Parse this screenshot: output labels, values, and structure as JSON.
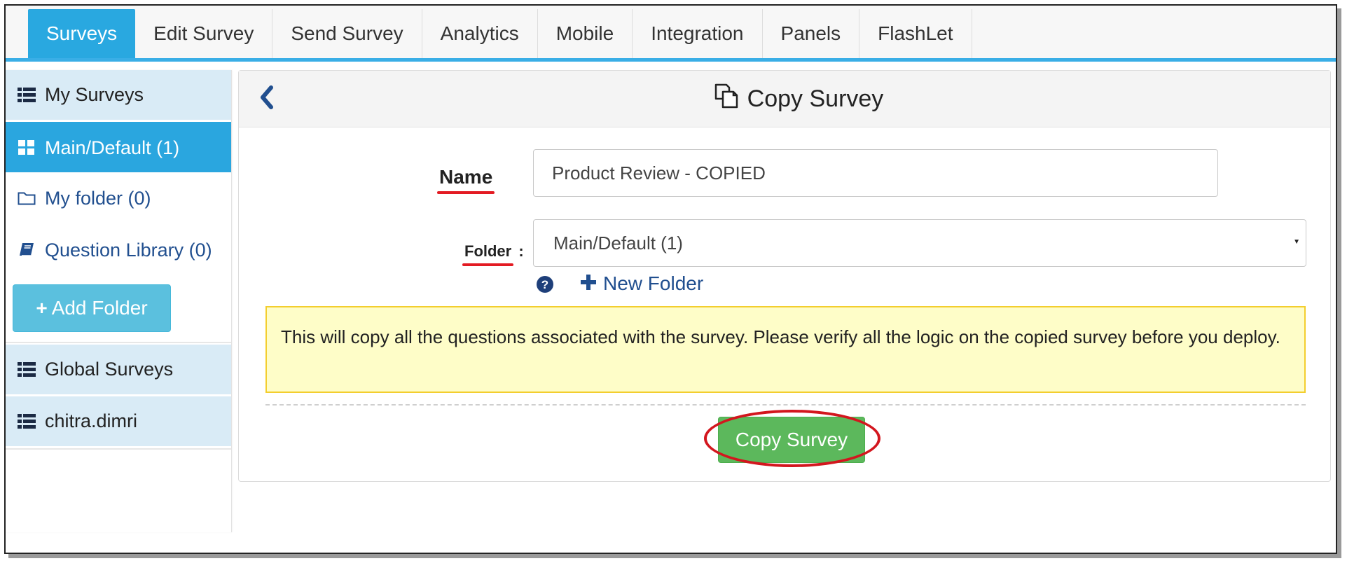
{
  "topnav": {
    "tabs": [
      {
        "label": "Surveys",
        "active": true
      },
      {
        "label": "Edit Survey"
      },
      {
        "label": "Send Survey"
      },
      {
        "label": "Analytics"
      },
      {
        "label": "Mobile"
      },
      {
        "label": "Integration"
      },
      {
        "label": "Panels"
      },
      {
        "label": "FlashLet"
      }
    ]
  },
  "sidebar": {
    "my_surveys": "My Surveys",
    "main_default": "Main/Default (1)",
    "my_folder": "My folder (0)",
    "question_library": "Question Library (0)",
    "add_folder": "Add Folder",
    "global_surveys": "Global Surveys",
    "user": "chitra.dimri"
  },
  "panel": {
    "title": "Copy Survey",
    "name_label": "Name",
    "name_value": "Product Review - COPIED",
    "folder_label": "Folder",
    "folder_colon": ":",
    "folder_value": "Main/Default (1)",
    "new_folder": "New Folder",
    "notice": "This will copy all the questions associated with the survey. Please verify all the logic on the copied survey before you deploy.",
    "copy_button": "Copy Survey"
  },
  "colors": {
    "accent": "#29a8e0",
    "sidebar_bg": "#d9ebf6",
    "success": "#5cb85c",
    "info": "#5bc0de",
    "annotation": "#e31b23",
    "notice_bg": "#fefdc8",
    "notice_border": "#f3ce2e"
  }
}
